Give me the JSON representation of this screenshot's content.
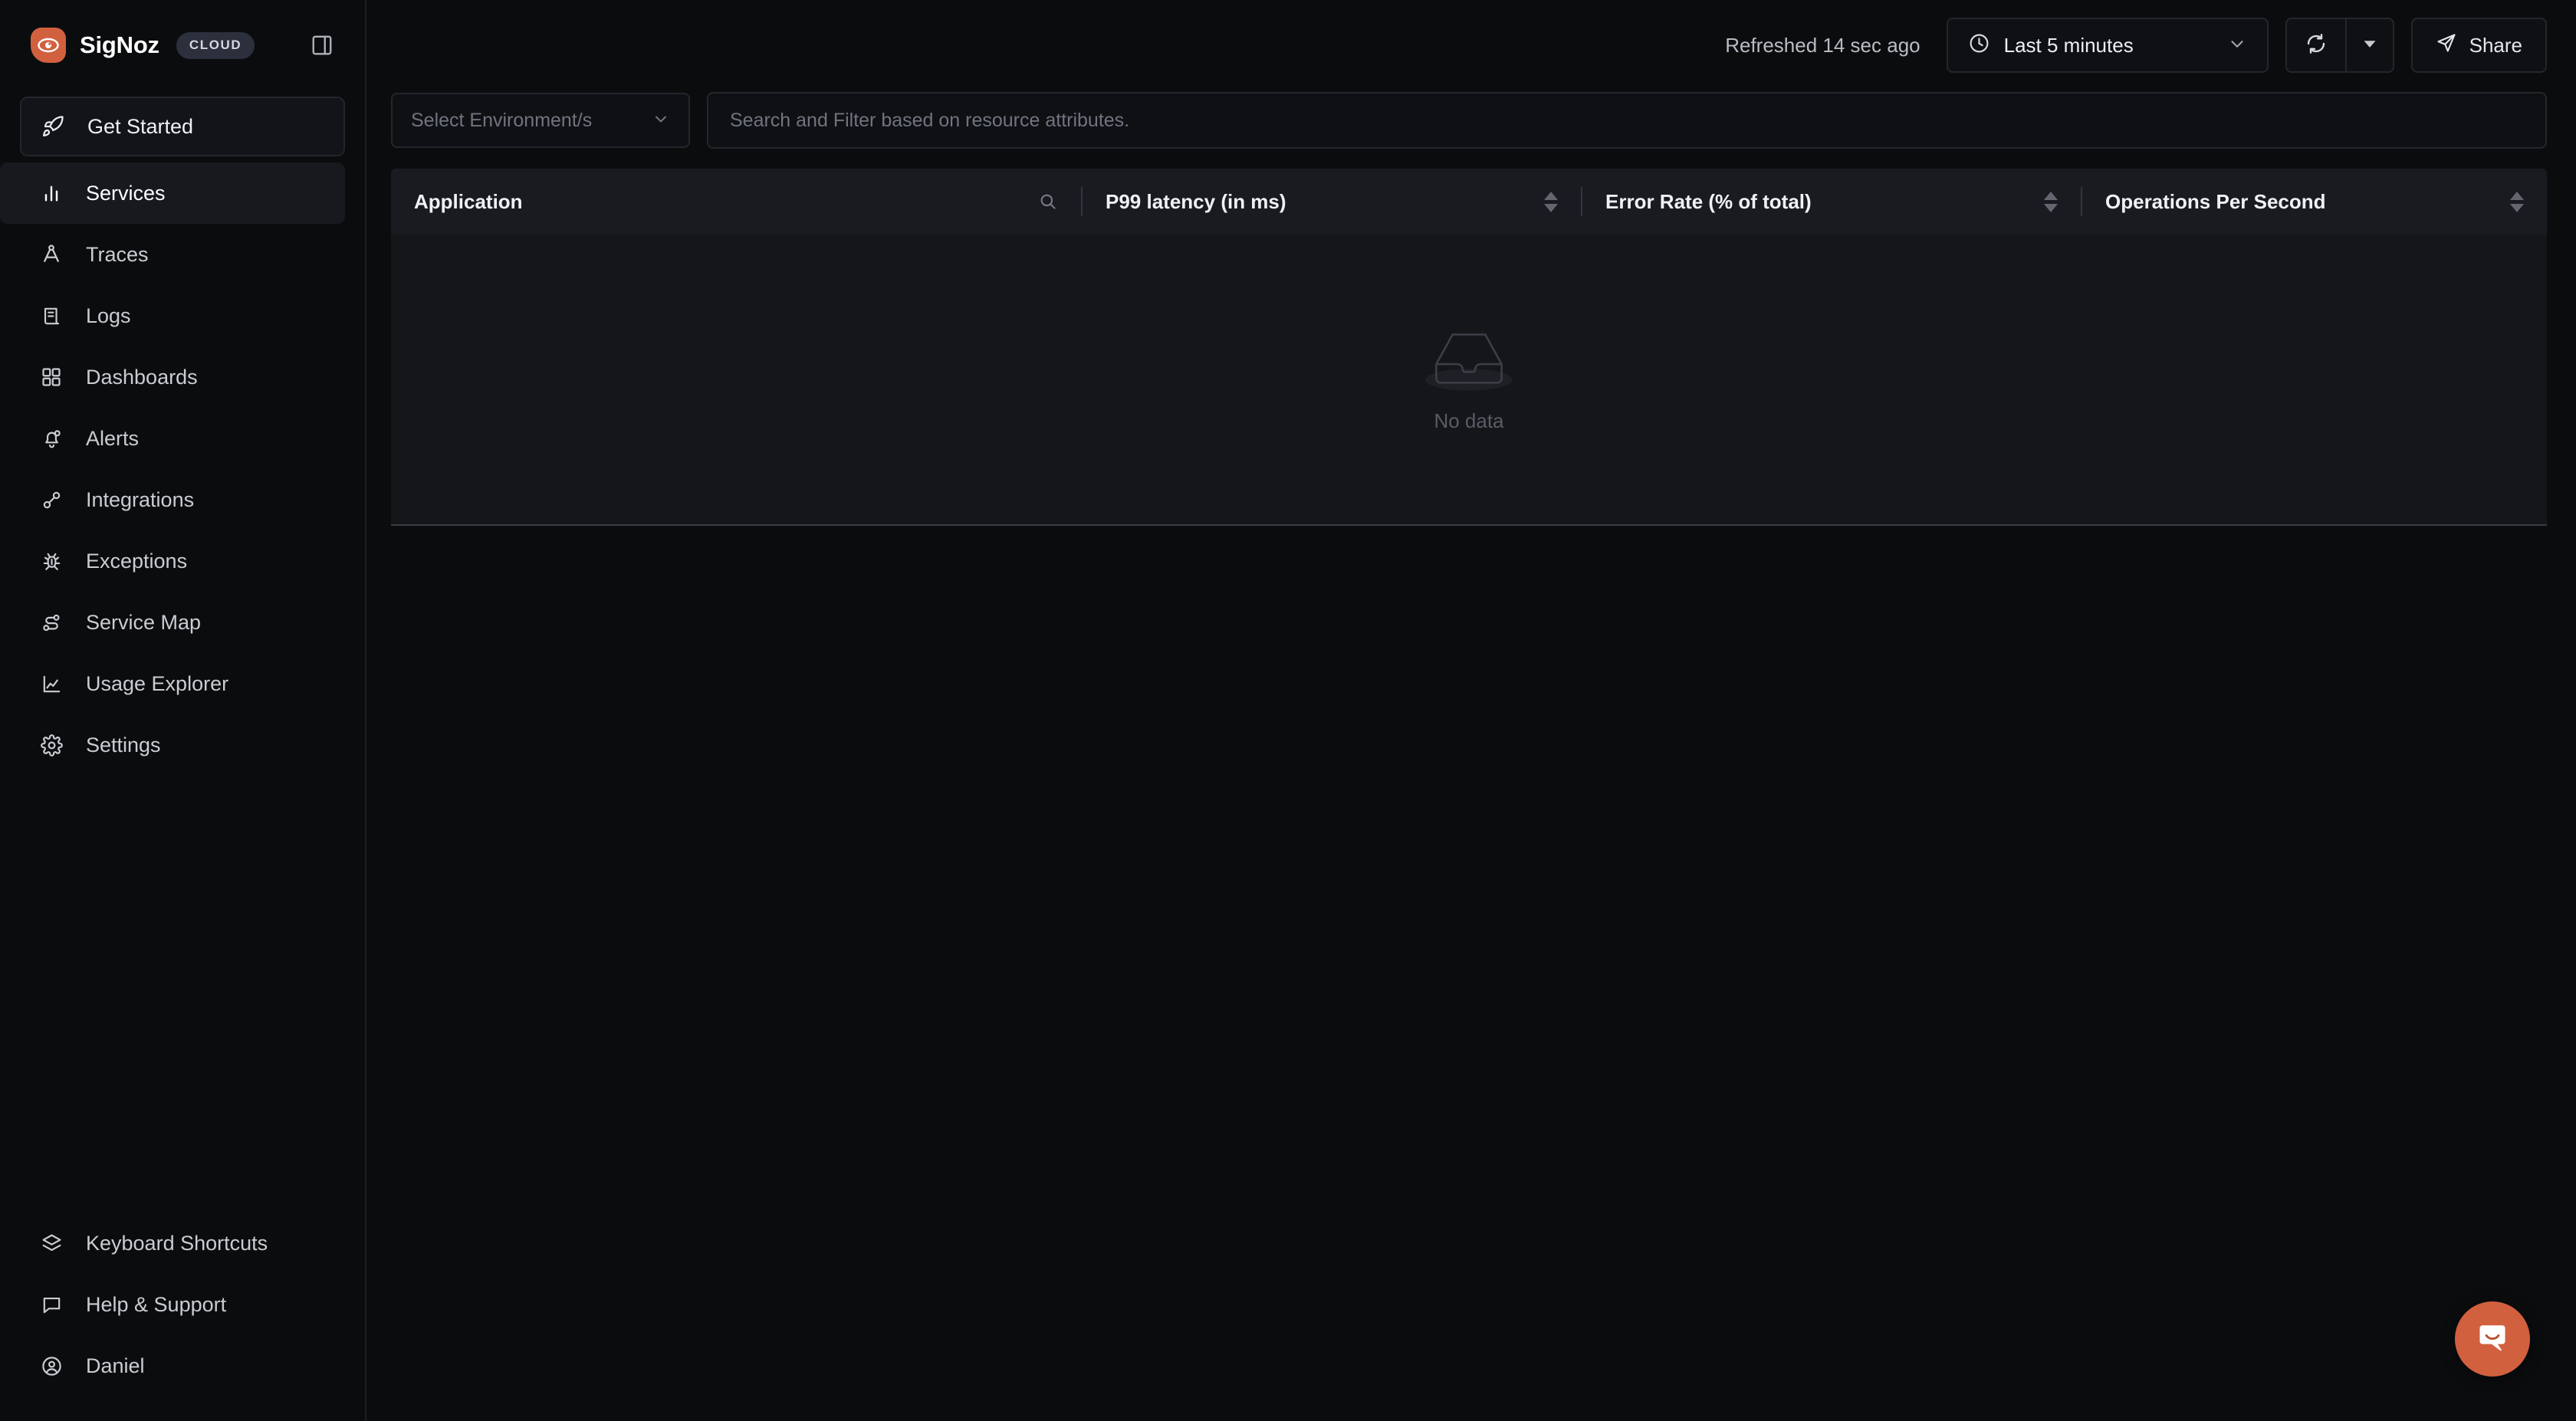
{
  "brand": {
    "name": "SigNoz",
    "badge": "CLOUD",
    "logo_icon": "signoz-eye-logo",
    "panel_toggle_icon": "sidebar-toggle-icon",
    "accent_color": "#d1603f"
  },
  "sidebar": {
    "primary_items": [
      {
        "label": "Get Started",
        "icon": "rocket-icon",
        "active": false
      },
      {
        "label": "Services",
        "icon": "bar-chart-icon",
        "active": true
      },
      {
        "label": "Traces",
        "icon": "traces-icon",
        "active": false
      },
      {
        "label": "Logs",
        "icon": "logs-scroll-icon",
        "active": false
      },
      {
        "label": "Dashboards",
        "icon": "grid-icon",
        "active": false
      },
      {
        "label": "Alerts",
        "icon": "bell-icon",
        "active": false
      },
      {
        "label": "Integrations",
        "icon": "plug-icon",
        "active": false
      },
      {
        "label": "Exceptions",
        "icon": "bug-icon",
        "active": false
      },
      {
        "label": "Service Map",
        "icon": "service-map-icon",
        "active": false
      },
      {
        "label": "Usage Explorer",
        "icon": "area-chart-icon",
        "active": false
      },
      {
        "label": "Settings",
        "icon": "gear-icon",
        "active": false
      }
    ],
    "secondary_items": [
      {
        "label": "Keyboard Shortcuts",
        "icon": "layers-icon"
      },
      {
        "label": "Help & Support",
        "icon": "chat-bubble-icon"
      },
      {
        "label": "Daniel",
        "icon": "user-circle-icon"
      }
    ],
    "active_indicator_color": "#4e74f8"
  },
  "toolbar": {
    "refreshed_text": "Refreshed 14 sec ago",
    "time_range": "Last 5 minutes",
    "time_icon": "clock-icon",
    "time_caret_icon": "chevron-down-icon",
    "refresh_icon": "refresh-icon",
    "refresh_dropdown_icon": "caret-down-icon",
    "share_label": "Share",
    "share_icon": "paper-plane-icon"
  },
  "filters": {
    "environment_placeholder": "Select Environment/s",
    "environment_caret_icon": "chevron-down-icon",
    "search_placeholder": "Search and Filter based on resource attributes."
  },
  "table": {
    "columns": [
      {
        "label": "Application",
        "icon": "search-icon",
        "sortable": false
      },
      {
        "label": "P99 latency (in ms)",
        "sortable": true
      },
      {
        "label": "Error Rate (% of total)",
        "sortable": true
      },
      {
        "label": "Operations Per Second",
        "sortable": true
      }
    ],
    "rows": [],
    "empty_text": "No data",
    "empty_icon": "empty-box-icon"
  },
  "chat": {
    "icon": "intercom-chat-icon",
    "color": "#d1603f"
  }
}
